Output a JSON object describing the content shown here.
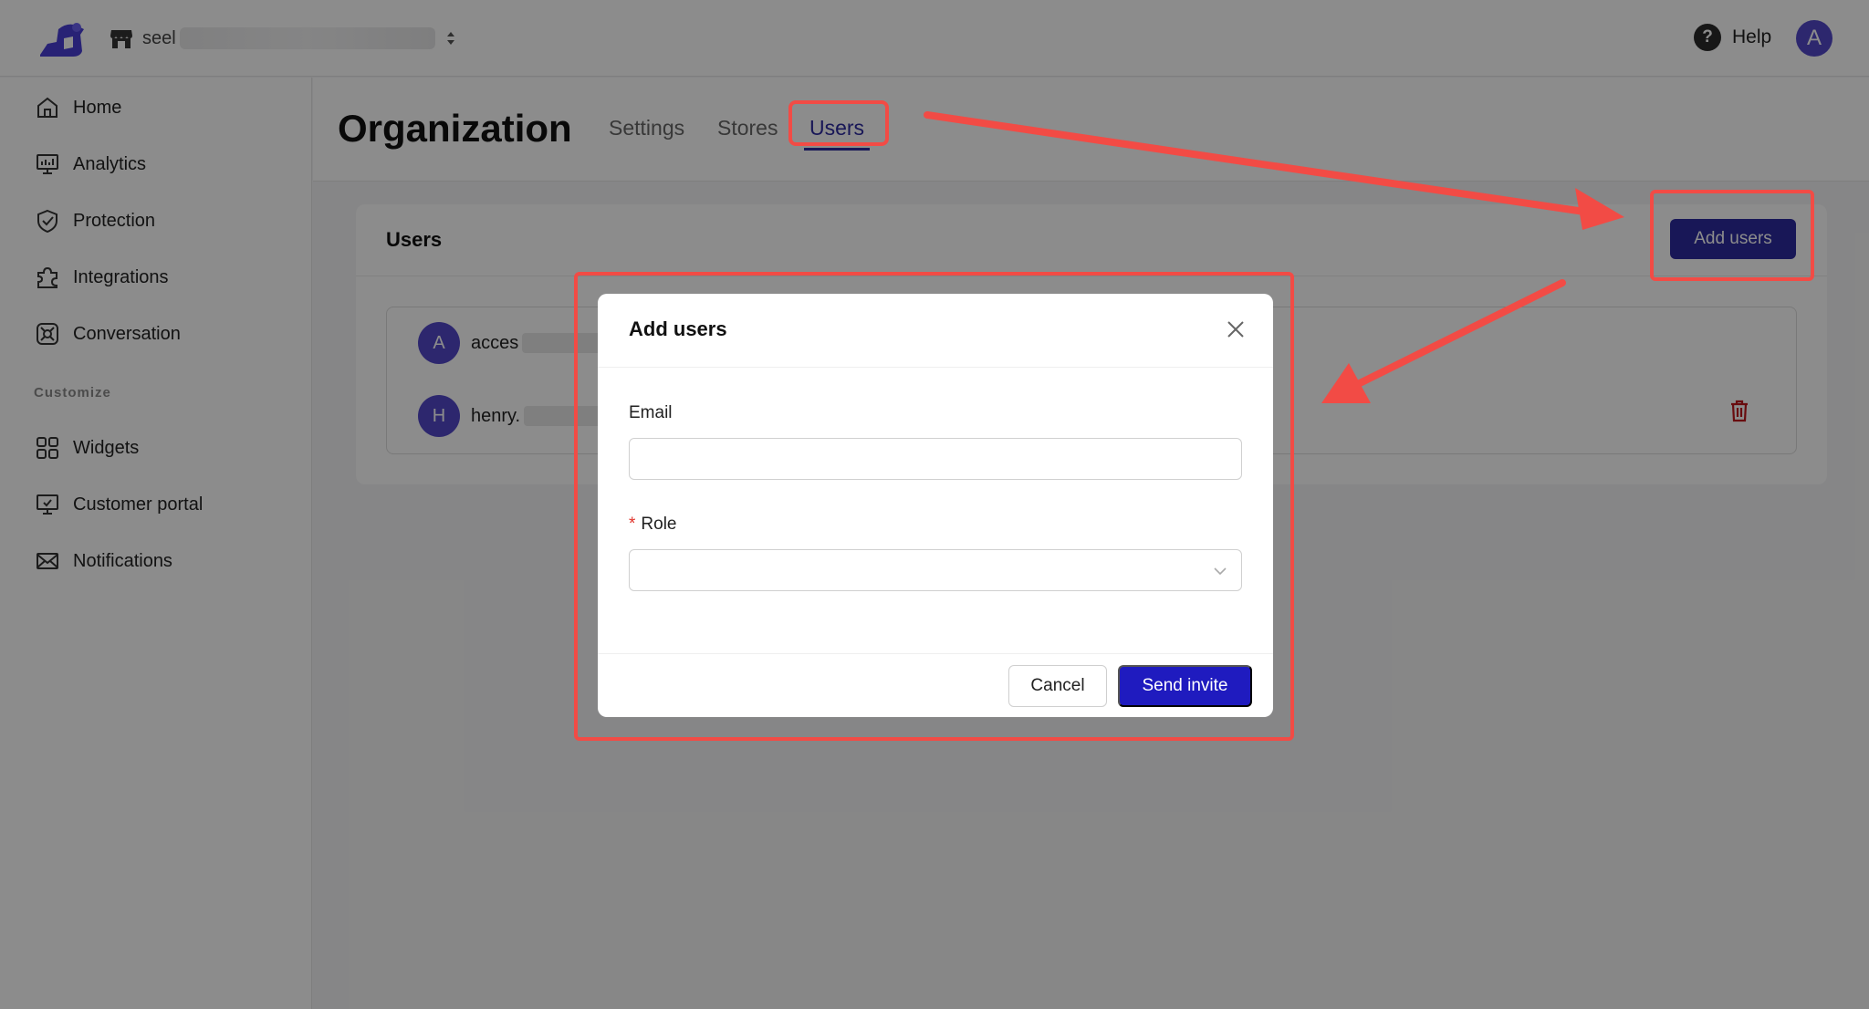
{
  "topbar": {
    "store_name": "seel",
    "help_label": "Help",
    "avatar_initial": "A"
  },
  "sidebar": {
    "items": [
      {
        "label": "Home",
        "icon": "home-icon"
      },
      {
        "label": "Analytics",
        "icon": "analytics-icon"
      },
      {
        "label": "Protection",
        "icon": "shield-check-icon"
      },
      {
        "label": "Integrations",
        "icon": "puzzle-icon"
      },
      {
        "label": "Conversation",
        "icon": "conversation-icon"
      }
    ],
    "section_label": "Customize",
    "customize_items": [
      {
        "label": "Widgets",
        "icon": "widgets-icon"
      },
      {
        "label": "Customer portal",
        "icon": "monitor-icon"
      },
      {
        "label": "Notifications",
        "icon": "mail-icon"
      }
    ]
  },
  "header": {
    "title": "Organization",
    "tabs": [
      {
        "label": "Settings",
        "active": false
      },
      {
        "label": "Stores",
        "active": false
      },
      {
        "label": "Users",
        "active": true
      }
    ]
  },
  "users_card": {
    "title": "Users",
    "add_button": "Add users",
    "rows": [
      {
        "initial": "A",
        "email": "acces"
      },
      {
        "initial": "H",
        "email": "henry."
      }
    ]
  },
  "modal": {
    "title": "Add users",
    "email_label": "Email",
    "email_value": "",
    "role_required_mark": "*",
    "role_label": "Role",
    "role_value": "",
    "cancel_label": "Cancel",
    "send_label": "Send invite"
  },
  "colors": {
    "primary": "#2d2a9f",
    "primary_button": "#1f1bbf",
    "avatar": "#5248c9",
    "annotation": "#f24b45",
    "danger": "#c0161d"
  }
}
